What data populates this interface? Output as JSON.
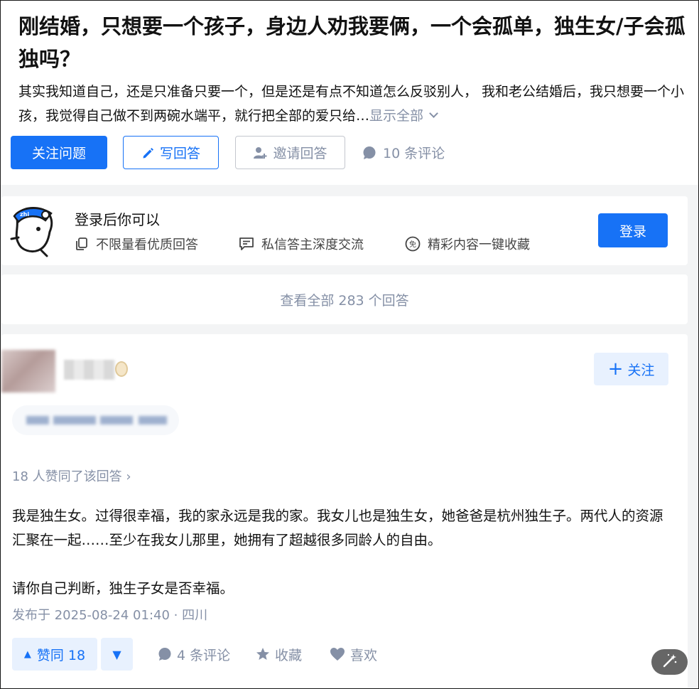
{
  "question": {
    "title": "刚结婚，只想要一个孩子，身边人劝我要俩，一个会孤单，独生女/子会孤独吗？",
    "description": "其实我知道自己，还是只准备只要一个，但是还是有点不知道怎么反驳别人， 我和老公结婚后，我只想要一个小孩，我觉得自己做不到两碗水端平，就行把全部的爱只给…",
    "show_all": "显示全部",
    "follow_label": "关注问题",
    "write_label": "写回答",
    "invite_label": "邀请回答",
    "comments_label": "10 条评论"
  },
  "login_card": {
    "title": "登录后你可以",
    "features": [
      "不限量看优质回答",
      "私信答主深度交流",
      "精彩内容一键收藏"
    ],
    "login_label": "登录"
  },
  "view_all_label": "查看全部 283 个回答",
  "answer": {
    "follow_label": "关注",
    "votes_text": "18 人赞同了该回答",
    "paragraphs": [
      "我是独生女。过得很幸福，我的家永远是我的家。我女儿也是独生女，她爸爸是杭州独生子。两代人的资源汇聚在一起……至少在我女儿那里，她拥有了超越很多同龄人的自由。",
      "请你自己判断，独生子女是否幸福。"
    ],
    "meta": "发布于 2025-08-24 01:40 · 四川",
    "upvote_label": "赞同 18",
    "comments_label": "4 条评论",
    "collect_label": "收藏",
    "like_label": "喜欢"
  },
  "colors": {
    "accent": "#1772f6",
    "muted": "#8590a6",
    "accent_light": "#e8f1fe"
  }
}
